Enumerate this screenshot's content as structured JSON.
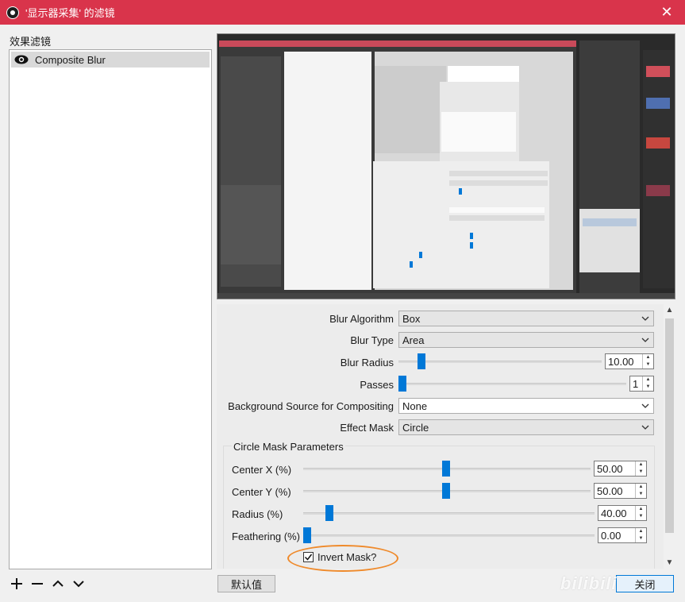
{
  "window": {
    "title": "'显示器采集' 的滤镜",
    "close_glyph": "✕",
    "accent_color": "#d9344b"
  },
  "filters": {
    "label": "效果滤镜",
    "items": [
      {
        "label": "Composite Blur",
        "visible": true
      }
    ],
    "tools": {
      "add": "+",
      "remove": "−"
    }
  },
  "properties": {
    "blur_algorithm": {
      "label": "Blur Algorithm",
      "value": "Box"
    },
    "blur_type": {
      "label": "Blur Type",
      "value": "Area"
    },
    "blur_radius": {
      "label": "Blur Radius",
      "value": "10.00",
      "level": 0.05
    },
    "passes": {
      "label": "Passes",
      "value": "1",
      "level": 0.0
    },
    "background_source": {
      "label": "Background Source for Compositing",
      "value": "None"
    },
    "effect_mask": {
      "label": "Effect Mask",
      "value": "Circle"
    },
    "circle_mask": {
      "title": "Circle Mask Parameters",
      "center_x": {
        "label": "Center X (%)",
        "value": "50.00",
        "level": 0.5
      },
      "center_y": {
        "label": "Center Y (%)",
        "value": "50.00",
        "level": 0.5
      },
      "radius": {
        "label": "Radius (%)",
        "value": "40.00",
        "level": 0.08
      },
      "feathering": {
        "label": "Feathering (%)",
        "value": "0.00",
        "level": 0.0
      },
      "invert_mask": {
        "label": "Invert Mask?",
        "checked": true
      }
    }
  },
  "buttons": {
    "defaults": "默认值",
    "close": "关闭"
  },
  "watermark": "bilibili"
}
